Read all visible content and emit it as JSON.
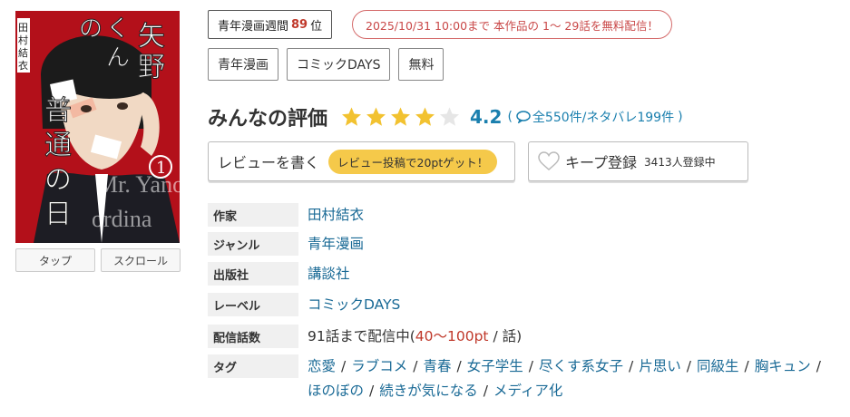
{
  "cover": {
    "title_vertical": "矢野くんの普通の日々",
    "author_vertical": "田村結衣",
    "volume": "1",
    "subtitle_en": "Mr. Yano's ordinary days",
    "overlay_en": "Mr. Yano ordina"
  },
  "view_buttons": [
    "タップ",
    "スクロール"
  ],
  "rank": {
    "prefix": "青年漫画週間",
    "number": "89",
    "suffix": "位"
  },
  "free_notice": "2025/10/31 10:00まで 本作品の 1〜 29話を無料配信！",
  "genre_chips": [
    "青年漫画",
    "コミックDAYS",
    "無料"
  ],
  "rating": {
    "title": "みんなの評価",
    "stars_filled": 4,
    "stars_total": 5,
    "score": "4.2",
    "open": "(",
    "count_text": "全550件/ネタバレ199件",
    "close": ")"
  },
  "review": {
    "label": "レビューを書く",
    "promo": "レビュー投稿で20ptゲット！"
  },
  "keep": {
    "label": "キープ登録",
    "count": "3413人登録中"
  },
  "info": {
    "author_label": "作家",
    "author": "田村結衣",
    "genre_label": "ジャンル",
    "genre": "青年漫画",
    "publisher_label": "出版社",
    "publisher": "講談社",
    "label_label": "レーベル",
    "label": "コミックDAYS",
    "episodes_label": "配信話数",
    "episodes_prefix": "91話まで配信中(",
    "episodes_price": "40〜100pt",
    "episodes_suffix": " / 話)",
    "tags_label": "タグ",
    "tags": [
      "恋愛",
      "ラブコメ",
      "青春",
      "女子学生",
      "尽くす系女子",
      "片思い",
      "同級生",
      "胸キュン",
      "ほのぼの",
      "続きが気になる",
      "メディア化"
    ]
  },
  "colors": {
    "accent_link": "#1a6a96",
    "score_blue": "#1a7fae",
    "star_gold": "#f2c230",
    "free_red": "#c94848",
    "promo_yellow": "#f5c94a",
    "cover_red": "#b3101a"
  }
}
